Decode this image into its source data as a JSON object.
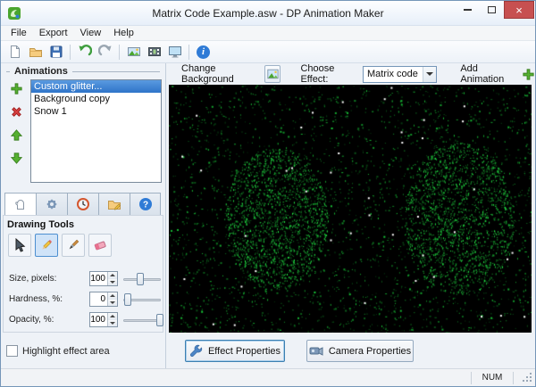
{
  "window": {
    "title": "Matrix Code Example.asw - DP Animation Maker"
  },
  "menu": {
    "items": [
      "File",
      "Export",
      "View",
      "Help"
    ]
  },
  "toolbar": {
    "buttons": [
      "new-document",
      "open-file",
      "save",
      "undo",
      "redo",
      "add-image",
      "export-video",
      "preview-screen",
      "info"
    ]
  },
  "animations": {
    "title": "Animations",
    "items": [
      {
        "label": "Custom glitter..."
      },
      {
        "label": "Background copy"
      },
      {
        "label": "Snow 1"
      }
    ]
  },
  "drawing_tools": {
    "title": "Drawing Tools",
    "size": {
      "label": "Size, pixels:",
      "value": "100"
    },
    "hardness": {
      "label": "Hardness, %:",
      "value": "0"
    },
    "opacity": {
      "label": "Opacity, %:",
      "value": "100"
    },
    "highlight_label": "Highlight effect area"
  },
  "effect_bar": {
    "change_background_label": "Change Background",
    "choose_effect_label": "Choose Effect:",
    "selected_effect": "Matrix code",
    "add_animation_label": "Add Animation"
  },
  "properties": {
    "effect_button": "Effect Properties",
    "camera_button": "Camera Properties"
  },
  "status": {
    "num": "NUM"
  },
  "colors": {
    "accent_green": "#55b030",
    "accent_red": "#d84040",
    "selection_blue": "#2f74c9",
    "matrix_green": "#00c040"
  }
}
